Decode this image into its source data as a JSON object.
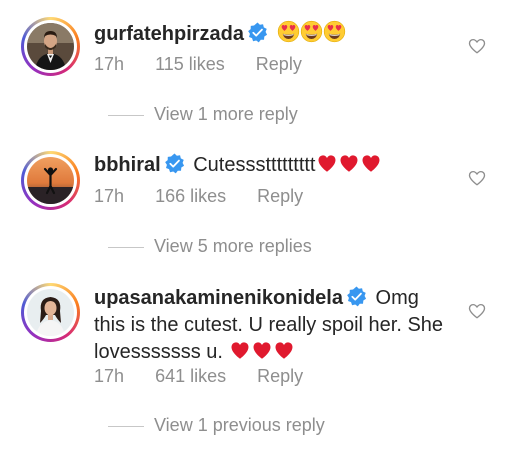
{
  "comments": [
    {
      "username": "gurfatehpirzada",
      "text": "",
      "emojis": [
        "heart-eyes",
        "heart-eyes",
        "heart-eyes"
      ],
      "time": "17h",
      "likes": "115 likes",
      "reply": "Reply",
      "view_more": "View 1 more reply"
    },
    {
      "username": "bbhiral",
      "text": "Cutesssttttttttt",
      "emojis": [
        "red-heart",
        "red-heart",
        "red-heart"
      ],
      "time": "17h",
      "likes": "166 likes",
      "reply": "Reply",
      "view_more": "View 5 more replies"
    },
    {
      "username": "upasanakaminenikonidela",
      "text": "Omg this is the cutest.  U really spoil her. She lovesssssss u.",
      "emojis": [
        "red-heart",
        "red-heart",
        "red-heart"
      ],
      "time": "17h",
      "likes": "641 likes",
      "reply": "Reply",
      "view_more": "View 1 previous reply"
    }
  ],
  "colors": {
    "text": "#262626",
    "secondary": "#8e8e8e",
    "verified": "#3897f0",
    "heart": "#ed4956"
  }
}
